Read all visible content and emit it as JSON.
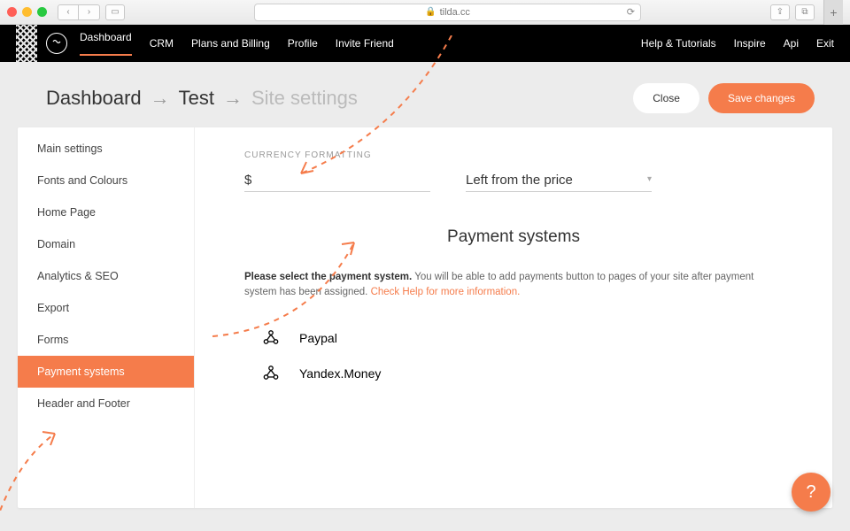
{
  "browser": {
    "url": "tilda.cc"
  },
  "topnav": {
    "left": [
      "Dashboard",
      "CRM",
      "Plans and Billing",
      "Profile",
      "Invite Friend"
    ],
    "right": [
      "Help & Tutorials",
      "Inspire",
      "Api",
      "Exit"
    ]
  },
  "breadcrumb": {
    "a": "Dashboard",
    "b": "Test",
    "c": "Site settings"
  },
  "buttons": {
    "close": "Close",
    "save": "Save changes"
  },
  "sidebar": {
    "items": [
      "Main settings",
      "Fonts and Colours",
      "Home Page",
      "Domain",
      "Analytics & SEO",
      "Export",
      "Forms",
      "Payment systems",
      "Header and Footer"
    ],
    "active_index": 7
  },
  "content": {
    "section_label": "CURRENCY FORMATTING",
    "currency_symbol": "$",
    "currency_position": "Left from the price",
    "ps_heading": "Payment systems",
    "ps_intro_bold": "Please select the payment system.",
    "ps_intro_rest": " You will be able to add payments button to pages of your site after payment system has been assigned. ",
    "ps_intro_link": "Check Help for more information.",
    "options": [
      "Paypal",
      "Yandex.Money"
    ]
  },
  "help_fab": "?"
}
